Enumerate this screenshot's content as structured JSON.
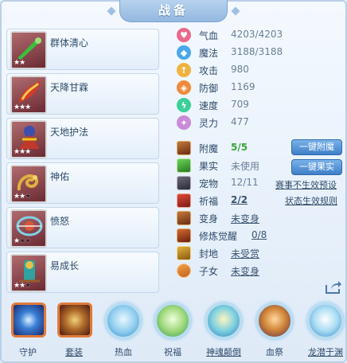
{
  "title": "战备",
  "cards": [
    {
      "name": "群体清心",
      "stars_filled": 2,
      "stars_total": 2
    },
    {
      "name": "天降甘霖",
      "stars_filled": 3,
      "stars_total": 3
    },
    {
      "name": "天地护法",
      "stars_filled": 3,
      "stars_total": 3
    },
    {
      "name": "神佑",
      "stars_filled": 2,
      "stars_total": 3
    },
    {
      "name": "愤怒",
      "stars_filled": 1,
      "stars_total": 3
    },
    {
      "name": "易成长",
      "stars_filled": 2,
      "stars_total": 3
    }
  ],
  "stats": [
    {
      "label": "气血",
      "value": "4203/4203",
      "icon": "heart-icon",
      "color": "#e86a8a"
    },
    {
      "label": "魔法",
      "value": "3188/3188",
      "icon": "mana-icon",
      "color": "#4aa8ea"
    },
    {
      "label": "攻击",
      "value": "980",
      "icon": "attack-icon",
      "color": "#f0b340"
    },
    {
      "label": "防御",
      "value": "1169",
      "icon": "defense-icon",
      "color": "#f08a3a"
    },
    {
      "label": "速度",
      "value": "709",
      "icon": "speed-icon",
      "color": "#3ccf9a"
    },
    {
      "label": "灵力",
      "value": "477",
      "icon": "spirit-icon",
      "color": "#c98ad8"
    }
  ],
  "slots": [
    {
      "label": "附魔",
      "value": "5/5",
      "style": "green"
    },
    {
      "label": "果实",
      "value": "未使用",
      "style": "plain"
    },
    {
      "label": "宠物",
      "value": "12/11",
      "style": "plain"
    },
    {
      "label": "祈福",
      "value": "2/2",
      "style": "green-u"
    },
    {
      "label": "变身",
      "value": "未变身",
      "style": "u"
    },
    {
      "label": "修炼觉醒",
      "value": "0/8",
      "style": "u"
    },
    {
      "label": "封地",
      "value": "未受赏",
      "style": "u"
    },
    {
      "label": "子女",
      "value": "未变身",
      "style": "u"
    }
  ],
  "buttons": {
    "enchant_all": "一键附魔",
    "fruit_all": "一键果实"
  },
  "links": {
    "match_preset": "赛事不生效预设",
    "state_rule": "状态生效规则"
  },
  "bottom": [
    {
      "label": "守护",
      "icon": "guard-icon",
      "kind": "square"
    },
    {
      "label": "套装",
      "icon": "suit-icon",
      "kind": "square"
    },
    {
      "label": "热血",
      "icon": "passion-icon",
      "kind": "circle"
    },
    {
      "label": "祝福",
      "icon": "blessing-icon",
      "kind": "circle"
    },
    {
      "label": "神魂颠倒",
      "icon": "soul-icon",
      "kind": "circle"
    },
    {
      "label": "血祭",
      "icon": "sacrifice-icon",
      "kind": "circle"
    },
    {
      "label": "龙潜于渊",
      "icon": "dragon-icon",
      "kind": "circle"
    }
  ]
}
